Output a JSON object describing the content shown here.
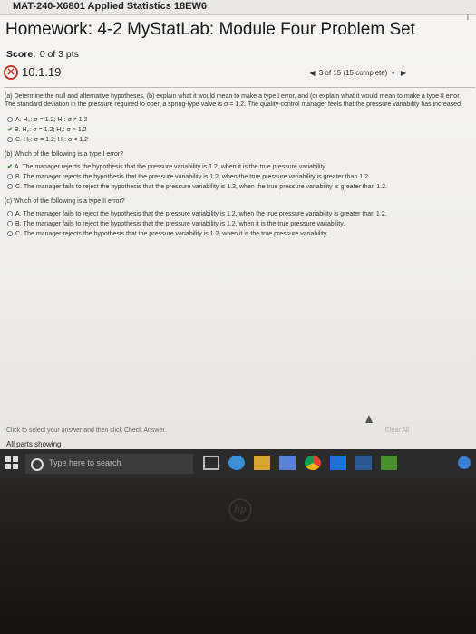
{
  "course": {
    "title": "MAT-240-X6801 Applied Statistics 18EW6",
    "corner": "T"
  },
  "homework": {
    "title": "Homework: 4-2 MyStatLab: Module Four Problem Set",
    "score_label": "Score:",
    "score_value": "0 of 3 pts"
  },
  "question": {
    "id": "10.1.19",
    "nav_text": "3 of 15 (15 complete)",
    "prev_arrow": "◀",
    "next_arrow": "▶"
  },
  "problem": {
    "intro": "(a) Determine the null and alternative hypotheses, (b) explain what it would mean to make a type I error, and (c) explain what it would mean to make a type II error. The standard deviation in the pressure required to open a spring-type valve is σ = 1.2. The quality-control manager feels that the pressure variability has increased.",
    "part_a_options": [
      {
        "letter": "A.",
        "text": "H₀: σ = 1.2; H₁: σ ≠ 1.2",
        "checked": false
      },
      {
        "letter": "B.",
        "text": "H₀: σ = 1.2; H₁: σ > 1.2",
        "checked": true
      },
      {
        "letter": "C.",
        "text": "H₀: σ = 1.2; H₁: σ < 1.2",
        "checked": false
      }
    ],
    "part_b_question": "(b) Which of the following is a type I error?",
    "part_b_options": [
      {
        "letter": "A.",
        "text": "The manager rejects the hypothesis that the pressure variability is 1.2, when it is the true pressure variability.",
        "checked": true
      },
      {
        "letter": "B.",
        "text": "The manager rejects the hypothesis that the pressure variability is 1.2, when the true pressure variability is greater than 1.2.",
        "checked": false
      },
      {
        "letter": "C.",
        "text": "The manager fails to reject the hypothesis that the pressure variability is 1.2, when the true pressure variability is greater than 1.2.",
        "checked": false
      }
    ],
    "part_c_question": "(c) Which of the following is a type II error?",
    "part_c_options": [
      {
        "letter": "A.",
        "text": "The manager fails to reject the hypothesis that the pressure variability is 1.2, when the true pressure variability is greater than 1.2.",
        "checked": false
      },
      {
        "letter": "B.",
        "text": "The manager fails to reject the hypothesis that the pressure variability is 1.2, when it is the true pressure variability.",
        "checked": false
      },
      {
        "letter": "C.",
        "text": "The manager rejects the hypothesis that the pressure variability is 1.2, when it is the true pressure variability.",
        "checked": false
      }
    ]
  },
  "footer": {
    "hint": "Click to select your answer and then click Check Answer.",
    "all_parts": "All parts showing",
    "clear_all": "Clear All"
  },
  "taskbar": {
    "search_placeholder": "Type here to search"
  },
  "bezel": {
    "logo": "hp"
  },
  "colors": {
    "error": "#c0392b",
    "correct": "#2e7d32",
    "taskbar": "#2b2b2b"
  }
}
